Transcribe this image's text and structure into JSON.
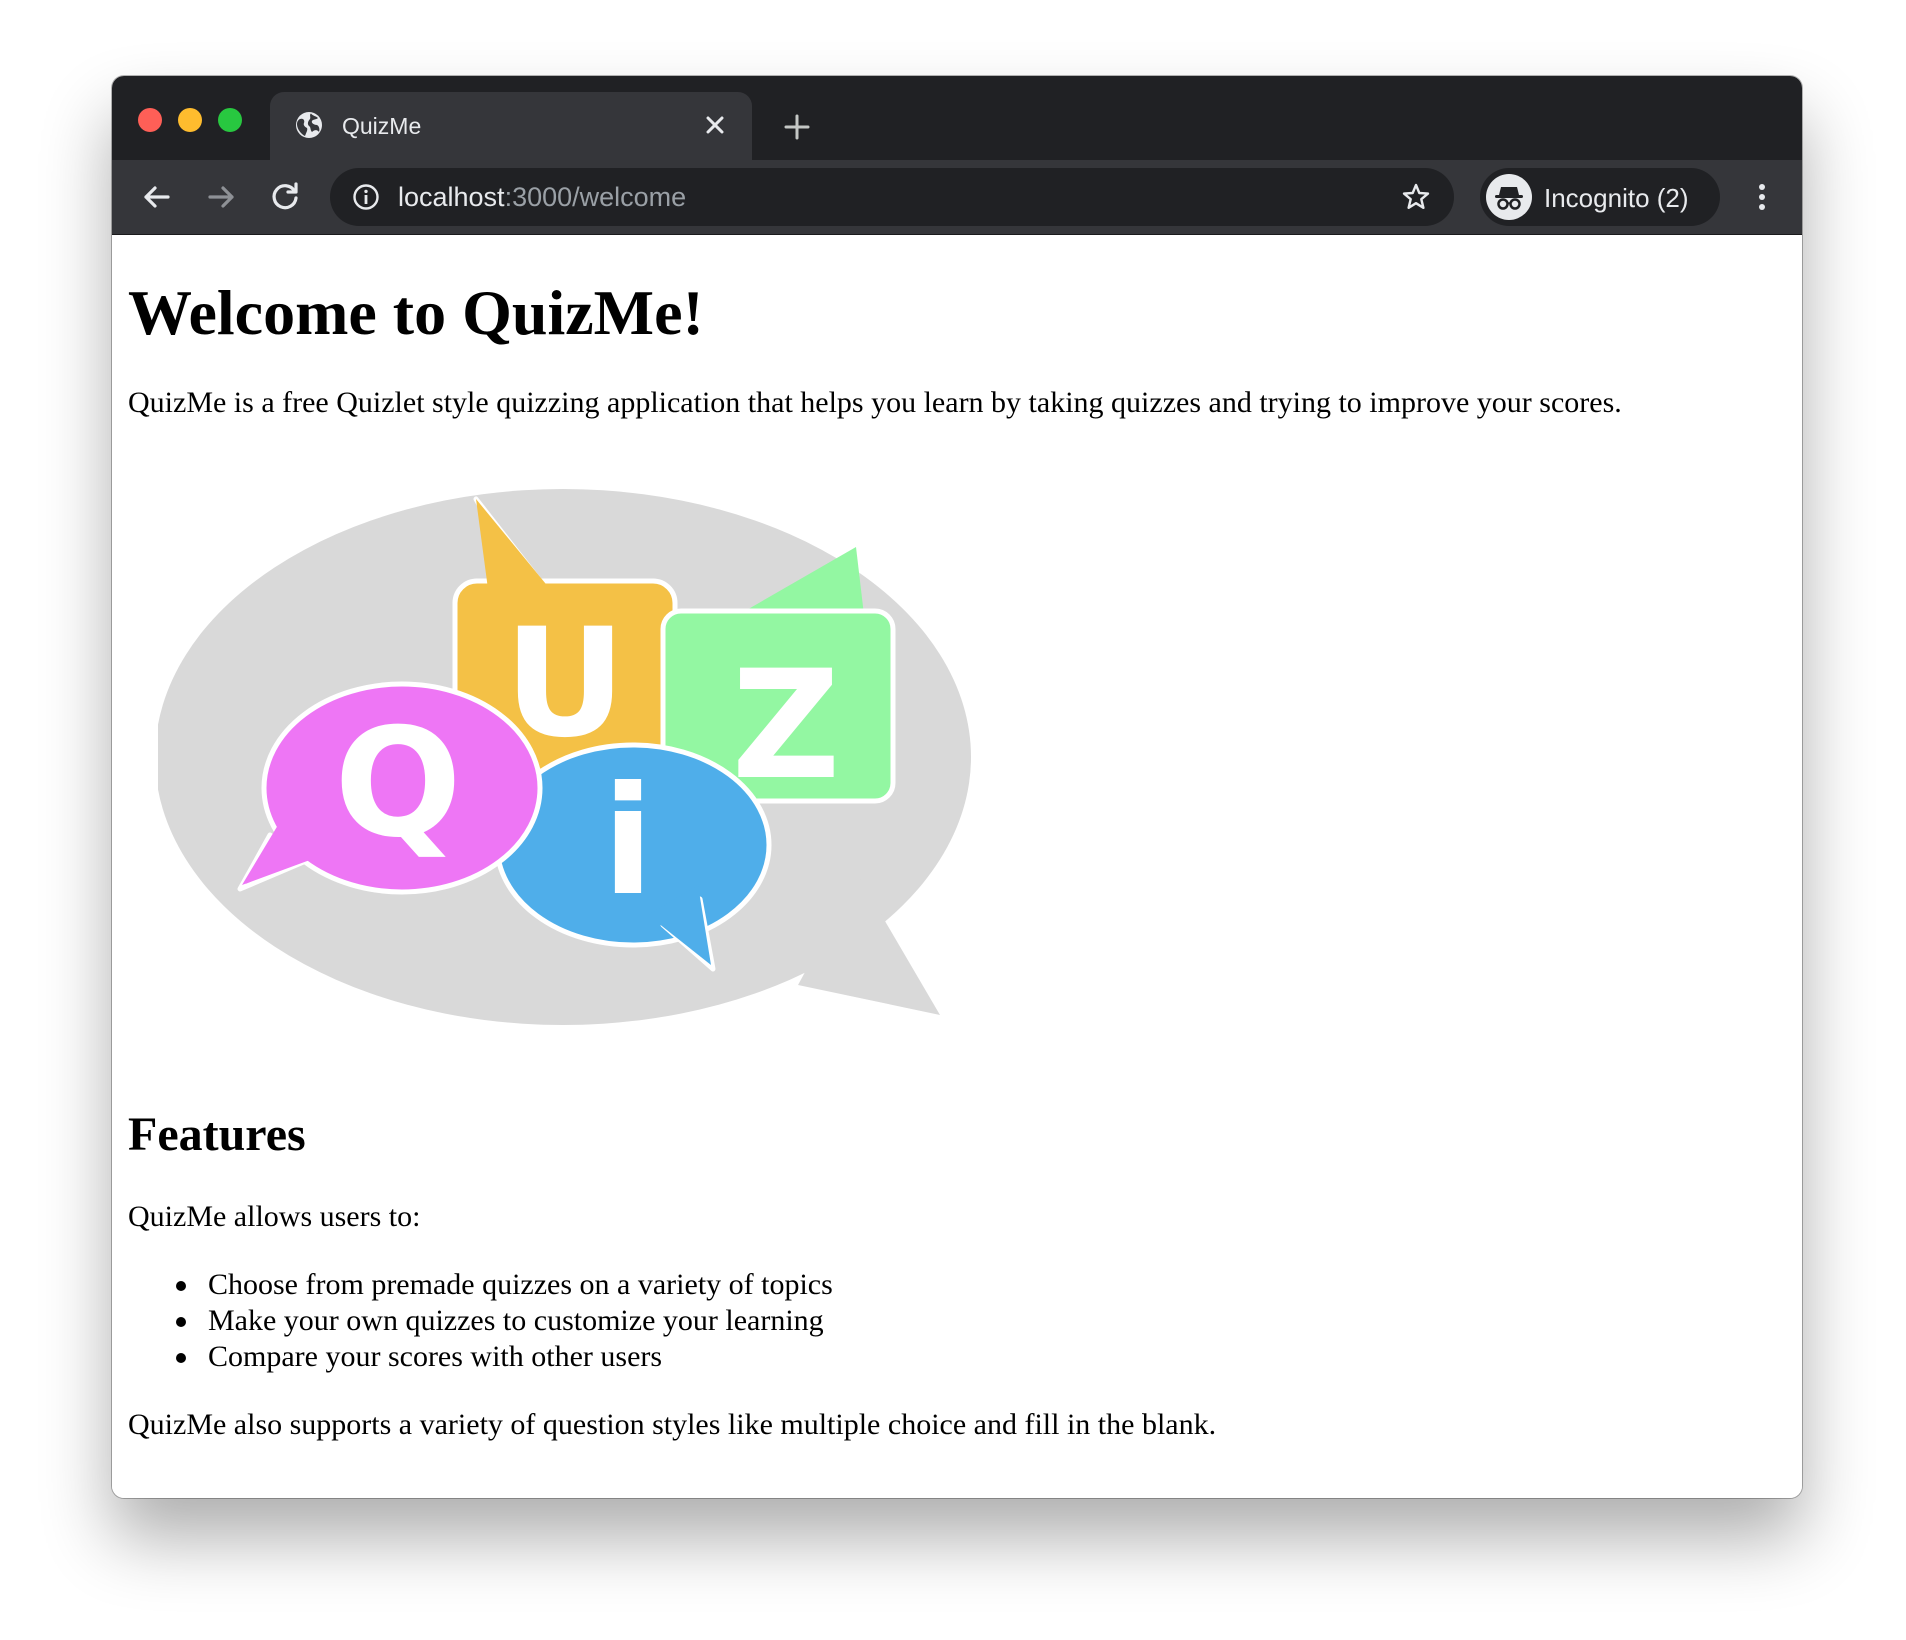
{
  "browser": {
    "tab": {
      "title": "QuizMe",
      "favicon_icon": "globe-icon"
    },
    "new_tab_icon": "plus-icon",
    "close_icon": "close-icon",
    "nav": {
      "back_icon": "arrow-left-icon",
      "forward_icon": "arrow-right-icon",
      "reload_icon": "reload-icon"
    },
    "omnibox": {
      "url_host": "localhost",
      "url_rest": ":3000/welcome",
      "info_icon": "info-icon",
      "bookmark_icon": "star-icon"
    },
    "profile": {
      "label": "Incognito (2)",
      "icon": "incognito-icon"
    },
    "menu_icon": "kebab-menu-icon"
  },
  "page": {
    "title": "Welcome to QuizMe!",
    "intro": "QuizMe is a free Quizlet style quizzing application that helps you learn by taking quizzes and trying to improve your scores.",
    "logo": {
      "letters": [
        "Q",
        "U",
        "i",
        "Z"
      ],
      "colors": {
        "background_bubble": "#d9d9d9",
        "q": "#ee76f5",
        "u": "#f4c146",
        "i": "#4faeea",
        "z": "#93f7a2"
      }
    },
    "features_heading": "Features",
    "allows_text": "QuizMe allows users to:",
    "features": [
      "Choose from premade quizzes on a variety of topics",
      "Make your own quizzes to customize your learning",
      "Compare your scores with other users"
    ],
    "more_text": "QuizMe also supports a variety of question styles like multiple choice and fill in the blank."
  }
}
